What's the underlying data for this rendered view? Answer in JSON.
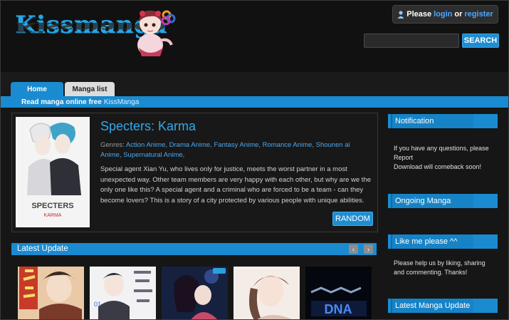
{
  "header": {
    "logo_text": "Kissmanga",
    "login": {
      "prefix": "Please",
      "login_link": "login",
      "or": "or",
      "register_link": "register"
    },
    "search": {
      "placeholder": "",
      "button_label": "SEARCH"
    }
  },
  "nav": {
    "tabs": [
      {
        "label": "Home",
        "active": true
      },
      {
        "label": "Manga list",
        "active": false
      }
    ],
    "subbar_text": "Read manga online free",
    "subbar_site": "KissManga"
  },
  "featured": {
    "title": "Specters: Karma",
    "cover_text": "SPECTERS",
    "cover_subtext": "KARMA",
    "genres_label": "Genres:",
    "genres": [
      "Action Anime",
      "Drama Anime",
      "Fantasy Anime",
      "Romance Anime",
      "Shounen ai Anime",
      "Supernatural Anime"
    ],
    "description": "Special agent Xian Yu, who lives only for justice, meets the worst partner in a most unexpected way. Other team members are very happy with each other, but why are we the only one like this? A special agent and a criminal who are forced to be a team - can they become lovers? This is a story of a city protected by various people with unique abilities.",
    "random_label": "RANDOM"
  },
  "latest_update": {
    "title": "Latest Update",
    "prev_icon": "‹",
    "next_icon": "›"
  },
  "sidebar": {
    "notification": {
      "title": "Notification",
      "lines": [
        "If you have any questions, please Report",
        "Download will comeback soon!"
      ]
    },
    "ongoing": {
      "title": "Ongoing Manga"
    },
    "likeme": {
      "title": "Like me please ^^",
      "text": "Please help us by liking, sharing and commenting. Thanks!"
    },
    "latest_manga": {
      "title": "Latest Manga Update"
    }
  },
  "colors": {
    "accent": "#1a8bd0",
    "background": "#161616",
    "link": "#4aa8f0",
    "title": "#34a8e8"
  }
}
